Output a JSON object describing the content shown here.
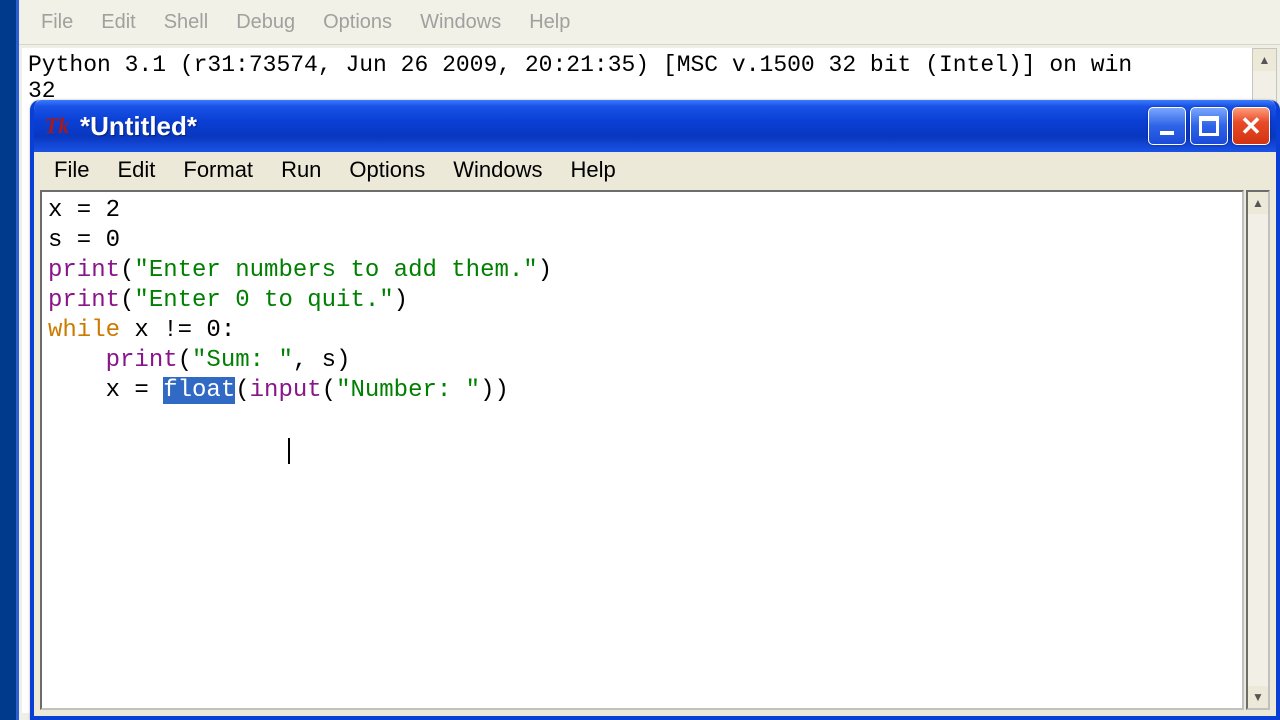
{
  "bg_window": {
    "menu": [
      "File",
      "Edit",
      "Shell",
      "Debug",
      "Options",
      "Windows",
      "Help"
    ],
    "shell_text": "Python 3.1 (r31:73574, Jun 26 2009, 20:21:35) [MSC v.1500 32 bit (Intel)] on win\n32"
  },
  "editor": {
    "tk_icon_label": "Tk",
    "title": "*Untitled*",
    "menu": [
      "File",
      "Edit",
      "Format",
      "Run",
      "Options",
      "Windows",
      "Help"
    ],
    "close_glyph": "✕",
    "code": {
      "l1_a": "x = 2",
      "l2_a": "s = 0",
      "l3_fn": "print",
      "l3_b": "(",
      "l3_str": "\"Enter numbers to add them.\"",
      "l3_c": ")",
      "l4_fn": "print",
      "l4_b": "(",
      "l4_str": "\"Enter 0 to quit.\"",
      "l4_c": ")",
      "l5_kw": "while",
      "l5_b": " x != 0:",
      "l6_indent": "    ",
      "l6_fn": "print",
      "l6_b": "(",
      "l6_str": "\"Sum: \"",
      "l6_c": ", s)",
      "l7_indent": "    x = ",
      "l7_sel": "float",
      "l7_b": "(",
      "l7_fn2": "input",
      "l7_c": "(",
      "l7_str": "\"Number: \"",
      "l7_d": "))"
    }
  }
}
